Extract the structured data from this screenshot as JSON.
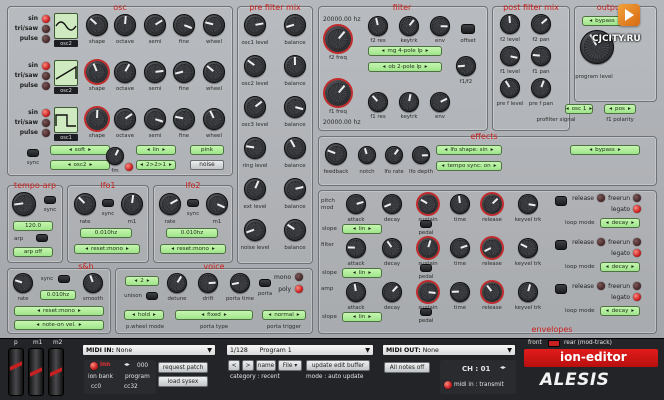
{
  "osc": {
    "title": "osc",
    "wave_names": [
      "sin",
      "tri/saw",
      "pulse"
    ],
    "osc_buttons": [
      "osc2",
      "osc2",
      "osc1"
    ],
    "knob_labels": [
      "shape",
      "octave",
      "semi",
      "fine",
      "wheel"
    ],
    "sync_label": "sync",
    "soft": "soft",
    "lin": "lin",
    "pink": "pink",
    "osc2_sel": "osc2",
    "ratio": "2>2>1",
    "noise": "noise",
    "fm": "fm"
  },
  "pre_filter_mix": {
    "title": "pre filter mix",
    "labels": [
      "osc1 level",
      "balance",
      "osc2 level",
      "balance",
      "osc3 level",
      "balance",
      "ring level",
      "balance",
      "ext level",
      "balance",
      "noise level",
      "balance"
    ]
  },
  "filter": {
    "title": "filter",
    "f2_freq_hz": "20000.00 hz",
    "f1_freq_hz": "20000.00 hz",
    "f2_freq": "f2 freq",
    "f1_freq": "f1 freq",
    "f2_res": "f2 res",
    "f2_keytrk": "keytrk",
    "f2_env": "env",
    "offset": "offset",
    "f1_f2": "f1/f2",
    "mode1": "mg 4-pole lp",
    "mode2": "ob 2-pole lp",
    "f1_res": "f1 res",
    "f1_keytrk": "keytrk",
    "f1_env": "env"
  },
  "post_filter_mix": {
    "title": "post filter mix",
    "labels": [
      "f2 level",
      "f2 pan",
      "f1 level",
      "f1 pan",
      "pre f level",
      "pre f pan"
    ],
    "profilter_signal": "profilter signal",
    "osc1": "osc 1",
    "pos": "pos",
    "f1_polarity": "f1 polarity"
  },
  "output": {
    "title": "output",
    "bypass": "bypass",
    "program_level": "program level"
  },
  "tempo_arp": {
    "title": "tempo-arp",
    "sync": "sync",
    "bpm": "120.0",
    "arp": "arp",
    "arp_off": "arp off"
  },
  "lfo1": {
    "title": "lfo1",
    "rate": "rate",
    "sync": "sync",
    "m1": "m1",
    "freq": "0.010hz",
    "reset": "reset:mono"
  },
  "lfo2": {
    "title": "lfo2",
    "rate": "rate",
    "sync": "sync",
    "m1": "m1",
    "freq": "0.010hz",
    "reset": "reset:mono"
  },
  "effects": {
    "title": "effects",
    "feedback": "feedback",
    "notch": "notch",
    "lfo_rate": "lfo rate",
    "lfo_depth": "lfo depth",
    "lfo_shape": "lfo shape: sin",
    "tempo_sync": "tempo sync: on",
    "bypass": "bypass"
  },
  "envelopes": {
    "title": "envelopes",
    "rows": [
      "pitch mod",
      "filter",
      "amp"
    ],
    "knob_labels": [
      "attack",
      "decay",
      "sustain",
      "time",
      "release",
      "keyvel trk"
    ],
    "slope": "slope",
    "lin": "lin",
    "pedal": "pedal",
    "release": "release",
    "freerun": "freerun",
    "legato": "legato",
    "loop_mode": "loop mode",
    "decay": "decay"
  },
  "sh": {
    "title": "s&h",
    "rate": "rate",
    "sync": "sync",
    "smooth": "smooth",
    "freq": "0.010hz",
    "reset": "reset:mono",
    "mode": "note-on vel."
  },
  "voice": {
    "title": "voice",
    "voices": "2",
    "unison": "unison",
    "detune": "detune",
    "drift": "drift",
    "porta_time": "porta time",
    "porta": "porta",
    "mono": "mono",
    "poly": "poly",
    "hold": "hold",
    "fixed": "fixed",
    "normal": "normal",
    "p_wheel_mode": "p.wheel mode",
    "porta_type": "porta type",
    "porta_trigger": "porta trigger"
  },
  "bottom": {
    "pitch_label": "p",
    "m1_label": "m1",
    "m2_label": "m2",
    "midi_in_label": "MIDI IN:",
    "midi_in_value": "None",
    "program_num": "1/128",
    "program_name": "Program 1",
    "midi_out_label": "MIDI OUT:",
    "midi_out_value": "None",
    "request_patch": "request patch",
    "load_sysex": "load sysex",
    "ion_bank": "ion bank",
    "program": "program",
    "prog_value": "000",
    "cc0": "cc0",
    "cc32": "cc32",
    "name": "name",
    "file": "File",
    "update_edit_buffer": "update edit buffer",
    "all_notes_off": "All notes off",
    "category": "category : recent",
    "mode": "mode : auto update",
    "ch": "CH : 01",
    "midi_transmit": "midi in : transmit",
    "front": "front",
    "rear": "rear (mod-track)",
    "brand": "ion-editor",
    "logo": "ALESIS",
    "site": "CJCITY.RU"
  },
  "colors": {
    "accent": "#c8201d",
    "lcd": "#a8e896",
    "panel": "#a7aaae",
    "brand_red": "#d31111"
  }
}
